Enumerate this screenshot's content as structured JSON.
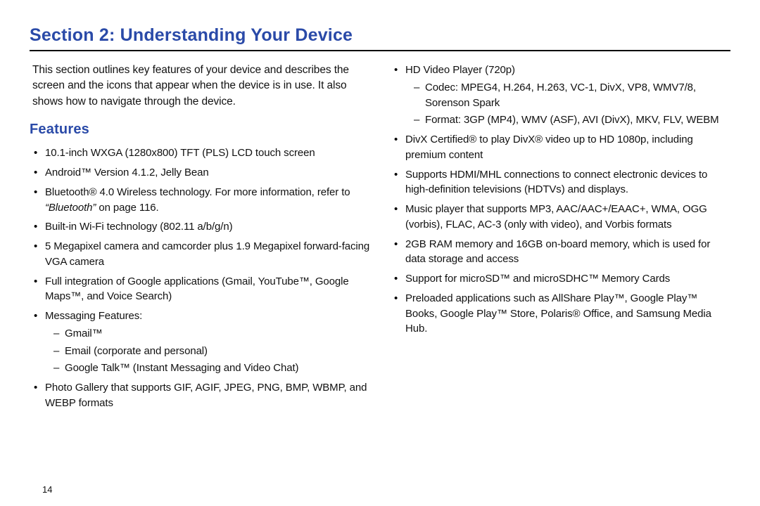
{
  "title": "Section 2: Understanding Your Device",
  "intro": "This section outlines key features of your device and describes the screen and the icons that appear when the device is in use. It also shows how to navigate through the device.",
  "features_heading": "Features",
  "left_items": {
    "0": "10.1-inch WXGA (1280x800) TFT (PLS) LCD touch screen",
    "1": "Android™ Version 4.1.2, Jelly Bean",
    "2_pre": "Bluetooth® 4.0 Wireless technology. For more information, refer to ",
    "2_ref": "“Bluetooth”",
    "2_post": "  on page 116.",
    "3": "Built-in Wi-Fi technology (802.11 a/b/g/n)",
    "4": "5 Megapixel camera and camcorder plus 1.9 Megapixel forward-facing VGA camera",
    "5": "Full integration of Google applications (Gmail, YouTube™, Google Maps™, and Voice Search)",
    "6": "Messaging Features:",
    "6_sub": {
      "0": "Gmail™",
      "1": "Email (corporate and personal)",
      "2": "Google Talk™ (Instant Messaging and Video Chat)"
    },
    "7": "Photo Gallery that supports GIF, AGIF, JPEG, PNG, BMP, WBMP, and WEBP formats"
  },
  "right_items": {
    "0": "HD Video Player (720p)",
    "0_sub": {
      "0": "Codec: MPEG4, H.264, H.263, VC-1, DivX, VP8, WMV7/8, Sorenson Spark",
      "1": "Format: 3GP (MP4), WMV (ASF), AVI (DivX), MKV, FLV, WEBM"
    },
    "1": "DivX Certified® to play DivX® video up to HD 1080p, including premium content",
    "2": "Supports HDMI/MHL connections to connect electronic devices to high-definition televisions (HDTVs) and displays.",
    "3": "Music player that supports MP3, AAC/AAC+/EAAC+, WMA, OGG (vorbis), FLAC, AC-3 (only with video), and Vorbis formats",
    "4": "2GB RAM memory and 16GB on-board memory, which is used for data storage and access",
    "5": "Support for microSD™ and microSDHC™ Memory Cards",
    "6": "Preloaded applications such as AllShare Play™, Google Play™ Books, Google Play™ Store, Polaris® Office, and Samsung Media Hub."
  },
  "page_number": "14"
}
